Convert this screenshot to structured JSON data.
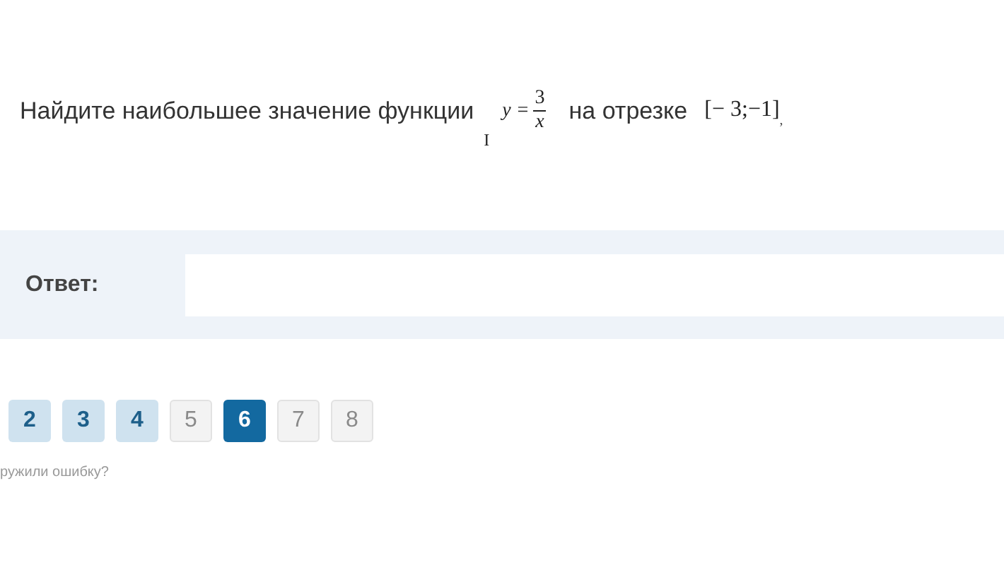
{
  "question": {
    "text": "Найдите наибольшее значение функции",
    "stray_mark": "I",
    "formula": {
      "lhs": "y =",
      "numerator": "3",
      "denominator": "x"
    },
    "connector": "на отрезке",
    "interval": "[− 3;−1]",
    "trailing_mark": ","
  },
  "answer": {
    "label": "Ответ:"
  },
  "pages": [
    {
      "label": "2",
      "kind": "answered",
      "selected": false
    },
    {
      "label": "3",
      "kind": "answered",
      "selected": false
    },
    {
      "label": "4",
      "kind": "answered",
      "selected": false
    },
    {
      "label": "5",
      "kind": "open",
      "selected": false
    },
    {
      "label": "6",
      "kind": "answered",
      "selected": true
    },
    {
      "label": "7",
      "kind": "open",
      "selected": false
    },
    {
      "label": "8",
      "kind": "open",
      "selected": false
    }
  ],
  "report_link": "ружили ошибку?"
}
